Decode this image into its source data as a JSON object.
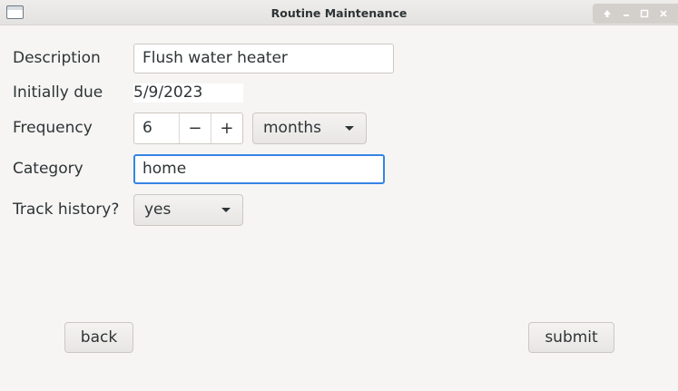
{
  "window": {
    "title": "Routine Maintenance",
    "controls": [
      "up-icon",
      "minimize-icon",
      "maximize-icon",
      "close-icon"
    ]
  },
  "form": {
    "description": {
      "label": "Description",
      "value": "Flush water heater"
    },
    "initially_due": {
      "label": "Initially due",
      "value": "5/9/2023"
    },
    "frequency": {
      "label": "Frequency",
      "value": "6",
      "decrement": "−",
      "increment": "+",
      "unit": "months"
    },
    "category": {
      "label": "Category",
      "value": "home"
    },
    "track_history": {
      "label": "Track history?",
      "value": "yes"
    }
  },
  "actions": {
    "back": "back",
    "submit": "submit"
  },
  "colors": {
    "focus": "#3584e4",
    "background": "#f6f5f4",
    "text": "#2e3436"
  }
}
